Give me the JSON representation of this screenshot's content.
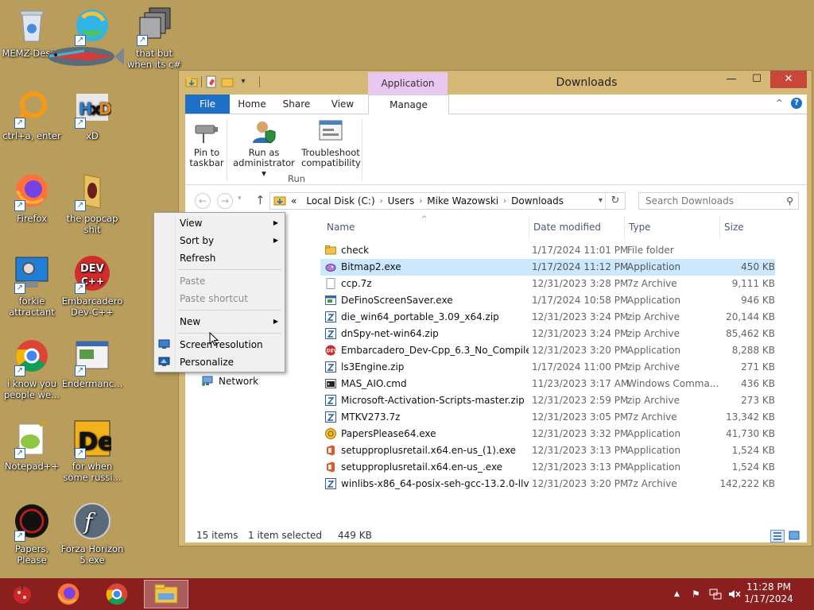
{
  "desktop": {
    "icons": [
      {
        "label": "MEMZ-Desi...",
        "icon": "recycle-bin-icon"
      },
      {
        "label": "...",
        "icon": "browser-icon"
      },
      {
        "label": "that but when its c#",
        "icon": "stacked-windows-icon"
      },
      {
        "label": "ctrl+a, enter",
        "icon": "magnifier-ring-icon"
      },
      {
        "label": "xD",
        "icon": "hxd-icon"
      },
      {
        "label": "Firefox",
        "icon": "firefox-icon"
      },
      {
        "label": "the popcap shit",
        "icon": "folder-icon"
      },
      {
        "label": "forkie attractant",
        "icon": "monitor-gear-icon"
      },
      {
        "label": "Embarcadero Dev-C++",
        "icon": "devcpp-icon"
      },
      {
        "label": "i know you people we...",
        "icon": "chrome-icon"
      },
      {
        "label": "Endermanc...",
        "icon": "window-app-icon"
      },
      {
        "label": "Notepad++",
        "icon": "notepadpp-icon"
      },
      {
        "label": "for when some russi...",
        "icon": "de-icon"
      },
      {
        "label": "Papers, Please",
        "icon": "papers-please-icon"
      },
      {
        "label": "Forza Horizon 5.exe",
        "icon": "flash-icon"
      }
    ]
  },
  "window": {
    "title": "Downloads",
    "app_tools": "Application Tools",
    "controls": {
      "minimize": "—",
      "maximize": "☐",
      "close": "✕"
    },
    "tabs": {
      "file": "File",
      "home": "Home",
      "share": "Share",
      "view": "View",
      "manage": "Manage"
    },
    "ribbon": {
      "pin": "Pin to taskbar",
      "run_admin": "Run as administrator",
      "troubleshoot": "Troubleshoot compatibility",
      "group_run": "Run"
    },
    "address": {
      "overflow": "«",
      "segments": [
        "Local Disk (C:)",
        "Users",
        "Mike Wazowski",
        "Downloads"
      ]
    },
    "search_placeholder": "Search Downloads",
    "navpane": {
      "network": "Network"
    },
    "columns": {
      "name": "Name",
      "date": "Date modified",
      "type": "Type",
      "size": "Size"
    },
    "files": [
      {
        "name": "check",
        "date": "1/17/2024 11:01 PM",
        "type": "File folder",
        "size": "",
        "icon": "folder"
      },
      {
        "name": "Bitmap2.exe",
        "date": "1/17/2024 11:12 PM",
        "type": "Application",
        "size": "450 KB",
        "icon": "exe-purple",
        "selected": true
      },
      {
        "name": "ccp.7z",
        "date": "12/31/2023 3:28 PM",
        "type": "7z Archive",
        "size": "9,111 KB",
        "icon": "blank"
      },
      {
        "name": "DeFinoScreenSaver.exe",
        "date": "1/17/2024 10:58 PM",
        "type": "Application",
        "size": "946 KB",
        "icon": "exe-window"
      },
      {
        "name": "die_win64_portable_3.09_x64.zip",
        "date": "12/31/2023 3:24 PM",
        "type": "zip Archive",
        "size": "20,144 KB",
        "icon": "zip"
      },
      {
        "name": "dnSpy-net-win64.zip",
        "date": "12/31/2023 3:24 PM",
        "type": "zip Archive",
        "size": "85,462 KB",
        "icon": "zip"
      },
      {
        "name": "Embarcadero_Dev-Cpp_6.3_No_Compiler...",
        "date": "12/31/2023 3:20 PM",
        "type": "Application",
        "size": "8,288 KB",
        "icon": "exe-red"
      },
      {
        "name": "ls3Engine.zip",
        "date": "1/17/2024 11:00 PM",
        "type": "zip Archive",
        "size": "271 KB",
        "icon": "zip"
      },
      {
        "name": "MAS_AIO.cmd",
        "date": "11/23/2023 3:17 AM",
        "type": "Windows Comma...",
        "size": "436 KB",
        "icon": "cmd"
      },
      {
        "name": "Microsoft-Activation-Scripts-master.zip",
        "date": "12/31/2023 2:59 PM",
        "type": "zip Archive",
        "size": "273 KB",
        "icon": "zip"
      },
      {
        "name": "MTKV273.7z",
        "date": "12/31/2023 3:05 PM",
        "type": "7z Archive",
        "size": "13,342 KB",
        "icon": "zip"
      },
      {
        "name": "PapersPlease64.exe",
        "date": "12/31/2023 3:32 PM",
        "type": "Application",
        "size": "41,730 KB",
        "icon": "exe-yellow"
      },
      {
        "name": "setupproplusretail.x64.en-us_(1).exe",
        "date": "12/31/2023 3:13 PM",
        "type": "Application",
        "size": "1,524 KB",
        "icon": "office"
      },
      {
        "name": "setupproplusretail.x64.en-us_.exe",
        "date": "12/31/2023 3:13 PM",
        "type": "Application",
        "size": "1,524 KB",
        "icon": "office"
      },
      {
        "name": "winlibs-x86_64-posix-seh-gcc-13.2.0-llv...",
        "date": "12/31/2023 3:20 PM",
        "type": "7z Archive",
        "size": "142,222 KB",
        "icon": "zip"
      }
    ],
    "status": {
      "count": "15 items",
      "selected": "1 item selected",
      "size": "449 KB"
    }
  },
  "context_menu": {
    "view": "View",
    "sort_by": "Sort by",
    "refresh": "Refresh",
    "paste": "Paste",
    "paste_shortcut": "Paste shortcut",
    "new": "New",
    "screen_resolution": "Screen resolution",
    "personalize": "Personalize"
  },
  "taskbar": {
    "time": "11:28 PM",
    "date": "1/17/2024"
  },
  "colors": {
    "accent": "#1e6fc6",
    "taskbar": "#8b1f1f",
    "desktop": "#b89d5c",
    "selection": "#cce8ff"
  }
}
